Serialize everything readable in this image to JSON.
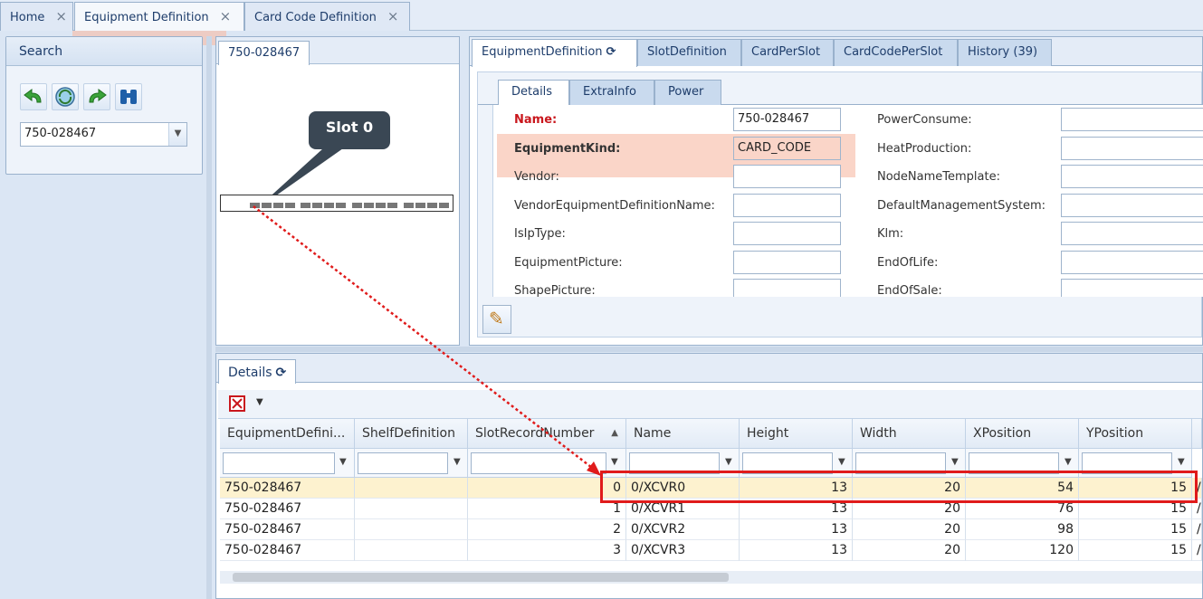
{
  "top_tabs": [
    {
      "label": "Home",
      "close": "×"
    },
    {
      "label": "Equipment Definition",
      "close": "×"
    },
    {
      "label": "Card Code Definition",
      "close": "×"
    }
  ],
  "search": {
    "title": "Search",
    "toolbar_icons": [
      "undo-arrow-icon",
      "refresh-globe-icon",
      "redo-arrow-icon",
      "binoculars-icon"
    ],
    "combo_value": "750-028467",
    "combo_dropdown": "▼"
  },
  "diagram": {
    "tab": "750-028467",
    "callout": "Slot 0"
  },
  "detail_tabs": [
    "EquipmentDefinition",
    "SlotDefinition",
    "CardPerSlot",
    "CardCodePerSlot",
    "History (39)"
  ],
  "refresh_glyph": "⟳",
  "inner_tabs": [
    "Details",
    "ExtraInfo",
    "Power"
  ],
  "form_left": [
    {
      "label": "Name:",
      "value": ""
    },
    {
      "label": "EquipmentKind:",
      "value": ""
    },
    {
      "label": "Vendor:",
      "value": ""
    },
    {
      "label": "VendorEquipmentDefinitionName:",
      "value": ""
    },
    {
      "label": "IsIpType:",
      "value": ""
    },
    {
      "label": "EquipmentPicture:",
      "value": ""
    },
    {
      "label": "ShapePicture:",
      "value": ""
    }
  ],
  "form_left_values": [
    "750-028467",
    "CARD_CODE",
    "",
    "",
    "",
    "",
    ""
  ],
  "form_right": [
    {
      "label": "PowerConsume:"
    },
    {
      "label": "HeatProduction:"
    },
    {
      "label": "NodeNameTemplate:"
    },
    {
      "label": "DefaultManagementSystem:"
    },
    {
      "label": "Klm:"
    },
    {
      "label": "EndOfLife:"
    },
    {
      "label": "EndOfSale:"
    }
  ],
  "edit_icon": "✎",
  "grid": {
    "tab": "Details",
    "sort_glyph": "▲",
    "filter_glyph": "▼",
    "export_icon": "export-icon",
    "columns": [
      "EquipmentDefini...",
      "ShelfDefinition",
      "SlotRecordNumber",
      "Name",
      "Height",
      "Width",
      "XPosition",
      "YPosition"
    ],
    "rows": [
      [
        "750-028467",
        "",
        "0",
        "0/XCVR0",
        "13",
        "20",
        "54",
        "15",
        "/("
      ],
      [
        "750-028467",
        "",
        "1",
        "0/XCVR1",
        "13",
        "20",
        "76",
        "15",
        "/"
      ],
      [
        "750-028467",
        "",
        "2",
        "0/XCVR2",
        "13",
        "20",
        "98",
        "15",
        "/"
      ],
      [
        "750-028467",
        "",
        "3",
        "0/XCVR3",
        "13",
        "20",
        "120",
        "15",
        "/"
      ]
    ]
  },
  "accent_colors": {
    "highlight_pink": "#f7beaa",
    "annotation_red": "#e01b1b",
    "selected_row": "#fdf2cf"
  }
}
